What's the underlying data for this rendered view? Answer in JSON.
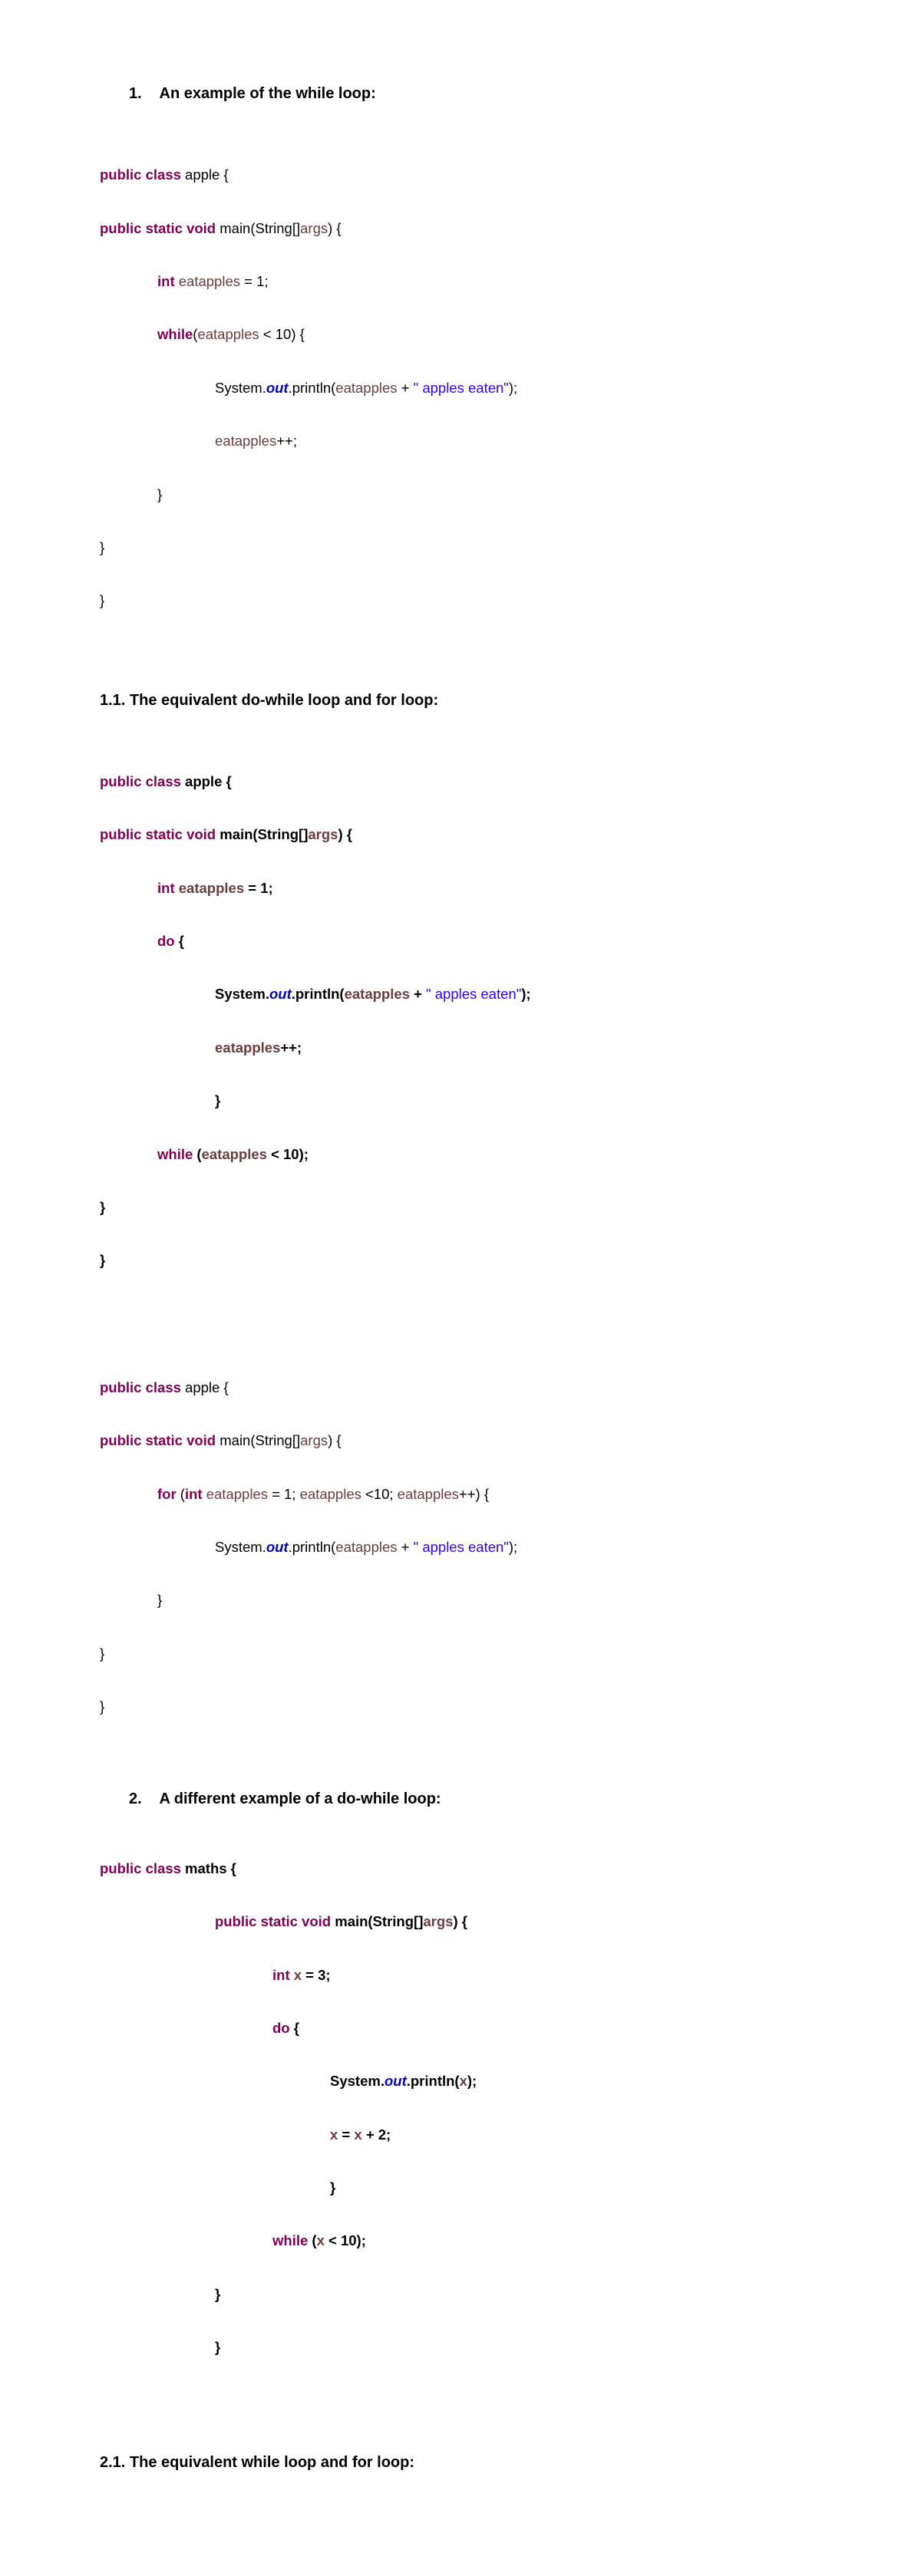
{
  "h1": {
    "num": "1.",
    "text": "An example of the while loop:"
  },
  "c1": {
    "l1a": "public class",
    "l1b": " apple {",
    "l2a": "public static void",
    "l2b": " main(String[]",
    "l2c": "args",
    "l2d": ") {",
    "l3a": "int",
    "l3b": " ",
    "l3c": "eatapples",
    "l3d": " = 1;",
    "l4a": "while",
    "l4b": "(",
    "l4c": "eatapples",
    "l4d": " < 10) {",
    "l5a": "System.",
    "l5b": "out",
    "l5c": ".println(",
    "l5d": "eatapples",
    "l5e": " + ",
    "l5f": "\" apples eaten\"",
    "l5g": ");",
    "l6a": "eatapples",
    "l6b": "++;",
    "l7": "}",
    "l8": "}",
    "l9": "}"
  },
  "sh11": "1.1. The equivalent do-while loop and for loop:",
  "c2": {
    "l1a": "public class",
    "l1b": " apple {",
    "l2a": "public static void",
    "l2b": " main(String[]",
    "l2c": "args",
    "l2d": ") {",
    "l3a": "int",
    "l3b": " ",
    "l3c": "eatapples",
    "l3d": " = 1;",
    "l4a": "do",
    "l4b": " {",
    "l5a": "System.",
    "l5b": "out",
    "l5c": ".println(",
    "l5d": "eatapples",
    "l5e": " + ",
    "l5f": "\" apples eaten\"",
    "l5g": ");",
    "l6a": "eatapples",
    "l6b": "++;",
    "l6c": "}",
    "l7a": "while",
    "l7b": " (",
    "l7c": "eatapples",
    "l7d": " < 10);",
    "l8": "}",
    "l9": "}"
  },
  "c3": {
    "l1a": "public class",
    "l1b": " apple {",
    "l2a": "public static void",
    "l2b": " main(String[]",
    "l2c": "args",
    "l2d": ") {",
    "l3a": "for",
    "l3b": " (",
    "l3c": "int",
    "l3d": " ",
    "l3e": "eatapples",
    "l3f": " = 1; ",
    "l3g": "eatapples",
    "l3h": " <10; ",
    "l3i": "eatapples",
    "l3j": "++) {",
    "l5a": "System.",
    "l5b": "out",
    "l5c": ".println(",
    "l5d": "eatapples",
    "l5e": " + ",
    "l5f": "\" apples eaten\"",
    "l5g": ");",
    "l7": "}",
    "l8": "}",
    "l9": "}"
  },
  "h2": {
    "num": "2.",
    "text": "A different example of a do-while loop:"
  },
  "c4": {
    "l1a": "public class",
    "l1b": " maths {",
    "l2a": "public static void",
    "l2b": " main(String[]",
    "l2c": "args",
    "l2d": ") {",
    "l3a": "int",
    "l3b": " ",
    "l3c": "x",
    "l3d": " = 3;",
    "l4a": "do",
    "l4b": " {",
    "l5a": "System.",
    "l5b": "out",
    "l5c": ".println(",
    "l5d": "x",
    "l5e": ");",
    "l6a": "x",
    "l6b": " = ",
    "l6c": "x",
    "l6d": " + 2;",
    "l6e": "}",
    "l7a": "while",
    "l7b": " (",
    "l7c": "x",
    "l7d": " < 10);",
    "l8": "}",
    "l9": "}"
  },
  "sh21": "2.1. The equivalent while loop and for loop:"
}
